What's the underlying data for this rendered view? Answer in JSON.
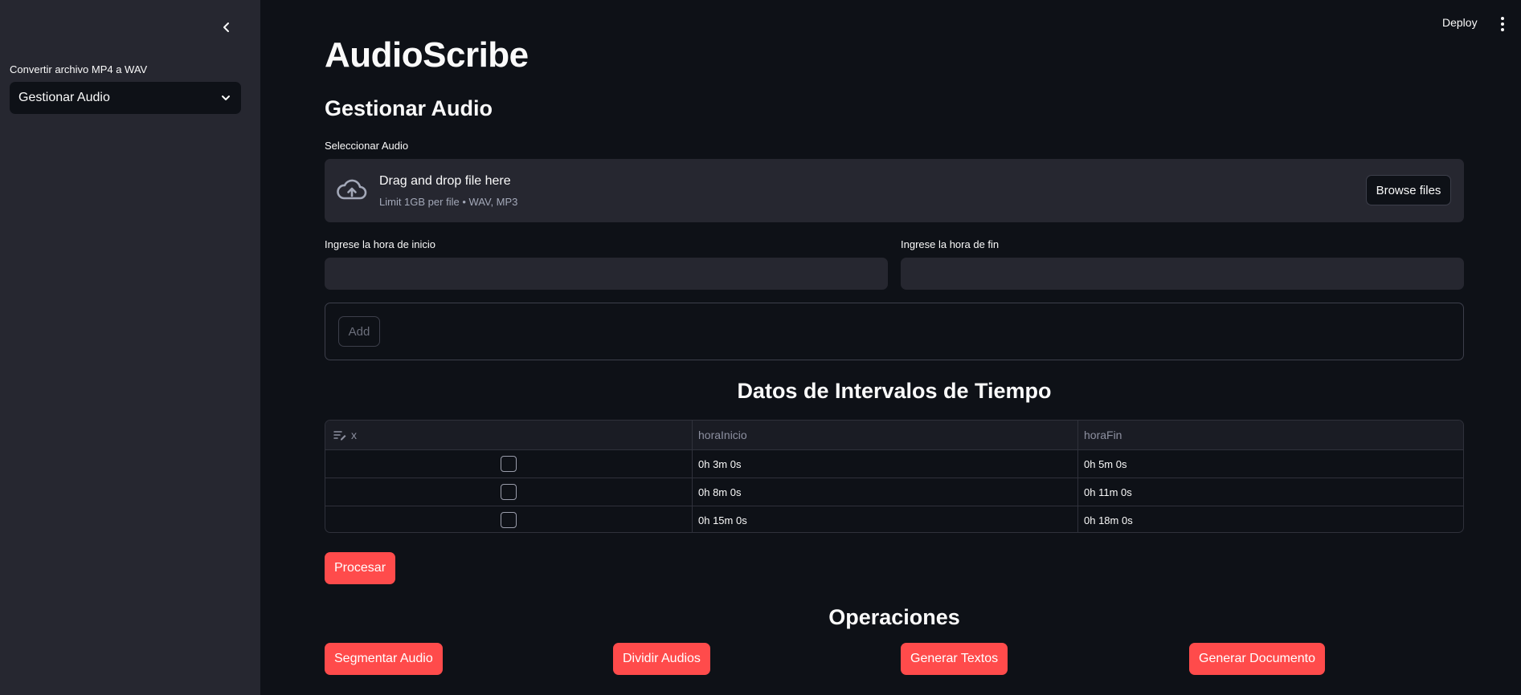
{
  "sidebar": {
    "label": "Convertir archivo MP4 a WAV",
    "select_value": "Gestionar Audio"
  },
  "topbar": {
    "deploy_label": "Deploy"
  },
  "main": {
    "title": "AudioScribe",
    "subtitle": "Gestionar Audio",
    "uploader": {
      "label": "Seleccionar Audio",
      "drop_text": "Drag and drop file here",
      "limit_text": "Limit 1GB per file • WAV, MP3",
      "browse_label": "Browse files"
    },
    "start_label": "Ingrese la hora de inicio",
    "end_label": "Ingrese la hora de fin",
    "start_value": "",
    "end_value": "",
    "add_label": "Add",
    "table_title": "Datos de Intervalos de Tiempo",
    "table": {
      "columns": [
        "x",
        "horaInicio",
        "horaFin"
      ],
      "rows": [
        {
          "inicio": "0h 3m 0s",
          "fin": "0h 5m 0s"
        },
        {
          "inicio": "0h 8m 0s",
          "fin": "0h 11m 0s"
        },
        {
          "inicio": "0h 15m 0s",
          "fin": "0h 18m 0s"
        }
      ]
    },
    "process_label": "Procesar",
    "operations_title": "Operaciones",
    "operations": [
      "Segmentar Audio",
      "Dividir Audios",
      "Generar Textos",
      "Generar Documento"
    ]
  },
  "colors": {
    "background": "#0e1117",
    "sidebar": "#262730",
    "primary": "#ff4b4b"
  }
}
